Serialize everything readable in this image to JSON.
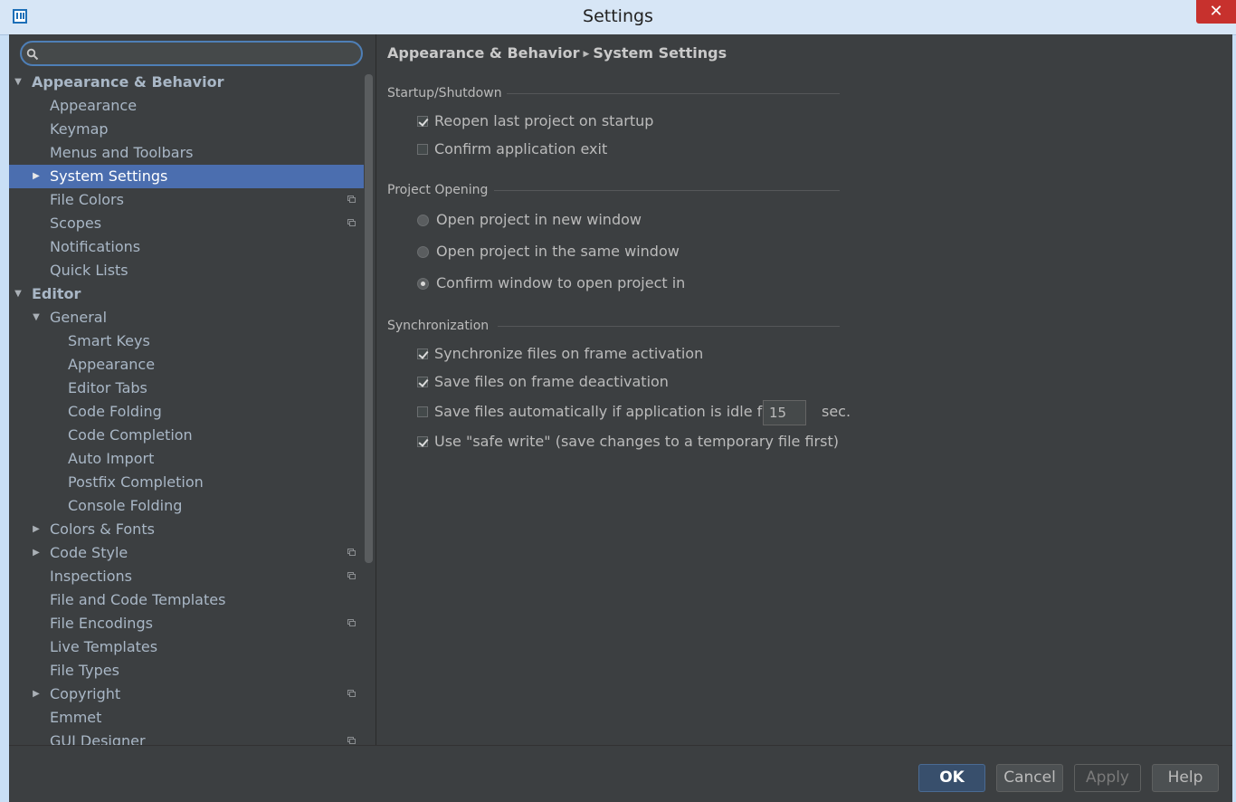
{
  "window": {
    "title": "Settings",
    "close_glyph": "✕"
  },
  "search": {
    "value": "",
    "placeholder": ""
  },
  "tree": [
    {
      "label": "Appearance & Behavior",
      "level": 0,
      "arrow": "▼",
      "top": true
    },
    {
      "label": "Appearance",
      "level": 1
    },
    {
      "label": "Keymap",
      "level": 1
    },
    {
      "label": "Menus and Toolbars",
      "level": 1
    },
    {
      "label": "System Settings",
      "level": 1,
      "arrow": "▶",
      "selected": true
    },
    {
      "label": "File Colors",
      "level": 1,
      "project": true
    },
    {
      "label": "Scopes",
      "level": 1,
      "project": true
    },
    {
      "label": "Notifications",
      "level": 1
    },
    {
      "label": "Quick Lists",
      "level": 1
    },
    {
      "label": "Editor",
      "level": 0,
      "arrow": "▼",
      "top": true
    },
    {
      "label": "General",
      "level": 1,
      "arrow": "▼"
    },
    {
      "label": "Smart Keys",
      "level": 2
    },
    {
      "label": "Appearance",
      "level": 2
    },
    {
      "label": "Editor Tabs",
      "level": 2
    },
    {
      "label": "Code Folding",
      "level": 2
    },
    {
      "label": "Code Completion",
      "level": 2
    },
    {
      "label": "Auto Import",
      "level": 2
    },
    {
      "label": "Postfix Completion",
      "level": 2
    },
    {
      "label": "Console Folding",
      "level": 2
    },
    {
      "label": "Colors & Fonts",
      "level": 1,
      "arrow": "▶"
    },
    {
      "label": "Code Style",
      "level": 1,
      "arrow": "▶",
      "project": true
    },
    {
      "label": "Inspections",
      "level": 1,
      "project": true
    },
    {
      "label": "File and Code Templates",
      "level": 1
    },
    {
      "label": "File Encodings",
      "level": 1,
      "project": true
    },
    {
      "label": "Live Templates",
      "level": 1
    },
    {
      "label": "File Types",
      "level": 1
    },
    {
      "label": "Copyright",
      "level": 1,
      "arrow": "▶",
      "project": true
    },
    {
      "label": "Emmet",
      "level": 1
    },
    {
      "label": "GUI Designer",
      "level": 1,
      "project": true
    }
  ],
  "breadcrumb": {
    "parent": "Appearance & Behavior",
    "current": "System Settings"
  },
  "startup": {
    "title": "Startup/Shutdown",
    "reopen_label": "Reopen last project on startup",
    "reopen_checked": true,
    "confirm_exit_label": "Confirm application exit",
    "confirm_exit_checked": false
  },
  "project_opening": {
    "title": "Project Opening",
    "options": [
      {
        "label": "Open project in new window",
        "selected": false
      },
      {
        "label": "Open project in the same window",
        "selected": false
      },
      {
        "label": "Confirm window to open project in",
        "selected": true
      }
    ]
  },
  "sync": {
    "title": "Synchronization",
    "sync_files_label": "Synchronize files on frame activation",
    "sync_files_checked": true,
    "save_deact_label": "Save files on frame deactivation",
    "save_deact_checked": true,
    "save_auto_label": "Save files automatically if application is idle for",
    "save_auto_checked": false,
    "idle_value": "15",
    "idle_unit": "sec.",
    "safe_write_label": "Use \"safe write\" (save changes to a temporary file first)",
    "safe_write_checked": true
  },
  "buttons": {
    "ok": "OK",
    "cancel": "Cancel",
    "apply": "Apply",
    "help": "Help"
  },
  "colors": {
    "selection": "#4b6eaf",
    "background": "#3c3f41",
    "accent": "#4e7fb7"
  }
}
